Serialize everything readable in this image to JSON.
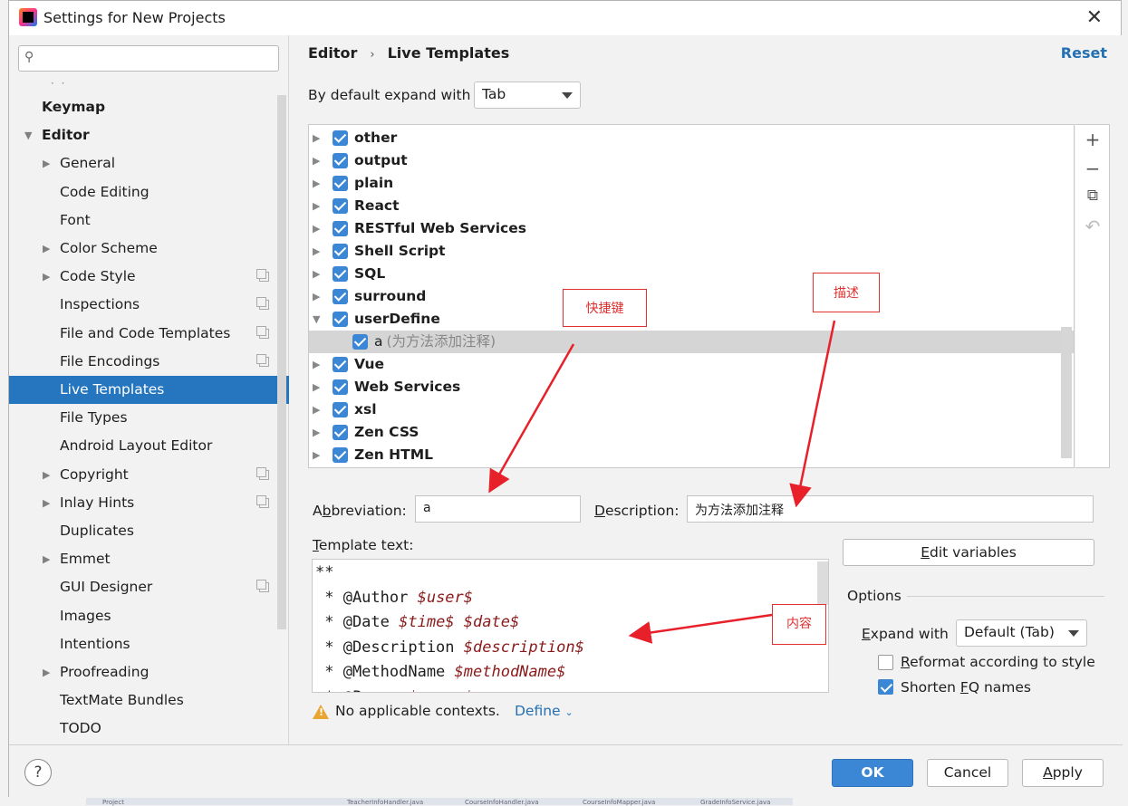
{
  "window": {
    "title": "Settings for New Projects",
    "close_label": "✕"
  },
  "sidebar": {
    "search": {
      "value": "",
      "placeholder": ""
    },
    "dots": "· ·",
    "items": [
      {
        "label": "Keymap",
        "level": 0,
        "bold": true,
        "arrow": "",
        "copy": false
      },
      {
        "label": "Editor",
        "level": 0,
        "bold": true,
        "arrow": "▼",
        "copy": false
      },
      {
        "label": "General",
        "level": 1,
        "arrow": "▶",
        "copy": false
      },
      {
        "label": "Code Editing",
        "level": 1,
        "arrow": "",
        "copy": false
      },
      {
        "label": "Font",
        "level": 1,
        "arrow": "",
        "copy": false
      },
      {
        "label": "Color Scheme",
        "level": 1,
        "arrow": "▶",
        "copy": false
      },
      {
        "label": "Code Style",
        "level": 1,
        "arrow": "▶",
        "copy": true
      },
      {
        "label": "Inspections",
        "level": 1,
        "arrow": "",
        "copy": true
      },
      {
        "label": "File and Code Templates",
        "level": 1,
        "arrow": "",
        "copy": true
      },
      {
        "label": "File Encodings",
        "level": 1,
        "arrow": "",
        "copy": true
      },
      {
        "label": "Live Templates",
        "level": 1,
        "arrow": "",
        "copy": false,
        "selected": true
      },
      {
        "label": "File Types",
        "level": 1,
        "arrow": "",
        "copy": false
      },
      {
        "label": "Android Layout Editor",
        "level": 1,
        "arrow": "",
        "copy": false
      },
      {
        "label": "Copyright",
        "level": 1,
        "arrow": "▶",
        "copy": true
      },
      {
        "label": "Inlay Hints",
        "level": 1,
        "arrow": "▶",
        "copy": true
      },
      {
        "label": "Duplicates",
        "level": 1,
        "arrow": "",
        "copy": false
      },
      {
        "label": "Emmet",
        "level": 1,
        "arrow": "▶",
        "copy": false
      },
      {
        "label": "GUI Designer",
        "level": 1,
        "arrow": "",
        "copy": true
      },
      {
        "label": "Images",
        "level": 1,
        "arrow": "",
        "copy": false
      },
      {
        "label": "Intentions",
        "level": 1,
        "arrow": "",
        "copy": false
      },
      {
        "label": "Proofreading",
        "level": 1,
        "arrow": "▶",
        "copy": false
      },
      {
        "label": "TextMate Bundles",
        "level": 1,
        "arrow": "",
        "copy": false
      },
      {
        "label": "TODO",
        "level": 1,
        "arrow": "",
        "copy": false
      }
    ]
  },
  "main": {
    "breadcrumb": {
      "parent": "Editor",
      "sep": "›",
      "current": "Live Templates"
    },
    "reset_label": "Reset",
    "expand": {
      "label": "By default expand with",
      "value": "Tab"
    },
    "template_groups": [
      {
        "name": "other",
        "expanded": false,
        "checked": true
      },
      {
        "name": "output",
        "expanded": false,
        "checked": true
      },
      {
        "name": "plain",
        "expanded": false,
        "checked": true
      },
      {
        "name": "React",
        "expanded": false,
        "checked": true
      },
      {
        "name": "RESTful Web Services",
        "expanded": false,
        "checked": true
      },
      {
        "name": "Shell Script",
        "expanded": false,
        "checked": true
      },
      {
        "name": "SQL",
        "expanded": false,
        "checked": true
      },
      {
        "name": "surround",
        "expanded": false,
        "checked": true
      },
      {
        "name": "userDefine",
        "expanded": true,
        "checked": true
      },
      {
        "name": "a",
        "child": true,
        "desc": "(为方法添加注释)",
        "checked": true,
        "selected": true
      },
      {
        "name": "Vue",
        "expanded": false,
        "checked": true
      },
      {
        "name": "Web Services",
        "expanded": false,
        "checked": true
      },
      {
        "name": "xsl",
        "expanded": false,
        "checked": true
      },
      {
        "name": "Zen CSS",
        "expanded": false,
        "checked": true
      },
      {
        "name": "Zen HTML",
        "expanded": false,
        "checked": true
      }
    ],
    "tools": {
      "add": "+",
      "remove": "−",
      "copy": "⧉",
      "undo": "↶"
    },
    "abbreviation": {
      "label_pre": "A",
      "label_u": "b",
      "label_post": "breviation:",
      "value": "a"
    },
    "description": {
      "label_u": "D",
      "label_post": "escription:",
      "value": "为方法添加注释"
    },
    "template_text": {
      "label_u": "T",
      "label_post": "emplate text:",
      "lines": [
        {
          "text": "**",
          "var": ""
        },
        {
          "text": " * @Author ",
          "var": "$user$"
        },
        {
          "text": " * @Date ",
          "var": "$time$ $date$"
        },
        {
          "text": " * @Description ",
          "var": "$description$"
        },
        {
          "text": " * @MethodName ",
          "var": "$methodName$"
        },
        {
          "text": " * @Param ",
          "var": "$param$"
        }
      ]
    },
    "edit_variables": {
      "u": "E",
      "rest": "dit variables"
    },
    "options": {
      "title": "Options",
      "expand_label_u": "E",
      "expand_label_rest": "xpand with",
      "expand_value": "Default (Tab)",
      "reformat": {
        "u": "R",
        "rest": "eformat according to style",
        "checked": false
      },
      "shorten": {
        "pre": "Shorten ",
        "u": "F",
        "rest": "Q names",
        "checked": true
      }
    },
    "warning": "No applicable contexts.",
    "define_label": "Define"
  },
  "annotations": {
    "shortcut": "快捷键",
    "describe": "描述",
    "content": "内容"
  },
  "footer": {
    "help": "?",
    "ok": "OK",
    "cancel": "Cancel",
    "apply": {
      "u": "A",
      "rest": "pply"
    }
  },
  "taskbar": [
    "Project",
    "TeacherInfoHandler.java",
    "CourseInfoHandler.java",
    "CourseInfoMapper.java",
    "GradeInfoService.java"
  ],
  "colors": {
    "accent": "#2675bf",
    "link": "#2470b3",
    "annotation": "#e03030",
    "checkbox": "#3b87d6"
  }
}
